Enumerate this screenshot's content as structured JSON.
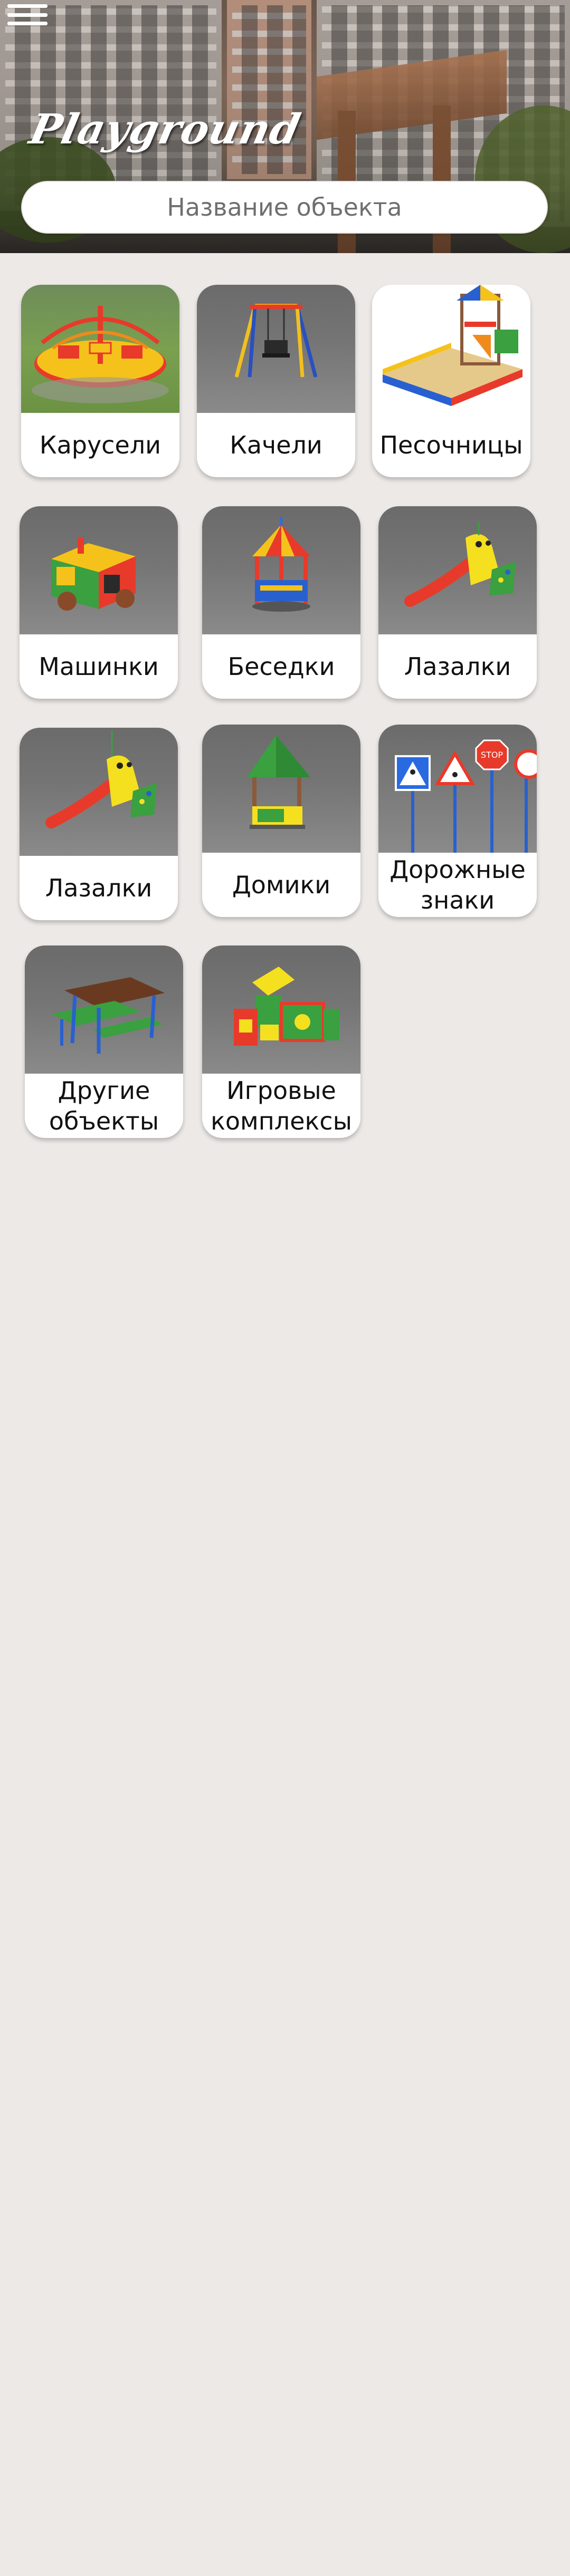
{
  "header": {
    "logo_text": "Playground",
    "menu_icon": "hamburger-menu-icon"
  },
  "search": {
    "placeholder": "Название объекта",
    "value": ""
  },
  "categories": [
    {
      "label": "Карусели",
      "icon": "carousel-image"
    },
    {
      "label": "Качели",
      "icon": "swing-image"
    },
    {
      "label": "Песочницы",
      "icon": "sandbox-image"
    },
    {
      "label": "Машинки",
      "icon": "toy-car-image"
    },
    {
      "label": "Беседки",
      "icon": "gazebo-image"
    },
    {
      "label": "Лазалки",
      "icon": "slide-image"
    },
    {
      "label": "Лазалки",
      "icon": "slide-image"
    },
    {
      "label": "Домики",
      "icon": "playhouse-image"
    },
    {
      "label": "Дорожные\nзнаки",
      "icon": "road-signs-image"
    },
    {
      "label": "Другие\nобъекты",
      "icon": "picnic-table-image"
    },
    {
      "label": "Игровые\nкомплексы",
      "icon": "play-complex-image"
    }
  ]
}
